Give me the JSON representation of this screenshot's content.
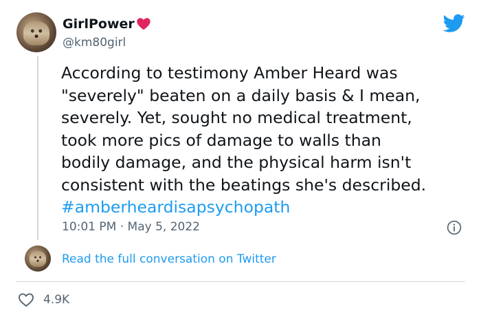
{
  "author": {
    "display_name": "GirlPower",
    "handle": "@km80girl"
  },
  "tweet": {
    "lines": [
      "According to testimony Amber Heard was",
      "\"severely\" beaten on a daily basis & I mean,",
      "severely. Yet, sought no medical treatment,",
      "took more pics of damage to walls than",
      "bodily damage, and the physical harm isn't",
      "consistent with the beatings she's described."
    ],
    "hashtag": "#amberheardisapsychopath",
    "timestamp": "10:01 PM · May 5, 2022"
  },
  "conversation_link": "Read the full conversation on Twitter",
  "likes": "4.9K",
  "colors": {
    "accent": "#1d9bf0",
    "heart": "#e0245e",
    "secondary_text": "#536471"
  },
  "icons": {
    "heart_emoji": "red-heart-icon",
    "brand": "twitter-bird-icon",
    "info": "info-icon",
    "like": "heart-outline-icon"
  }
}
